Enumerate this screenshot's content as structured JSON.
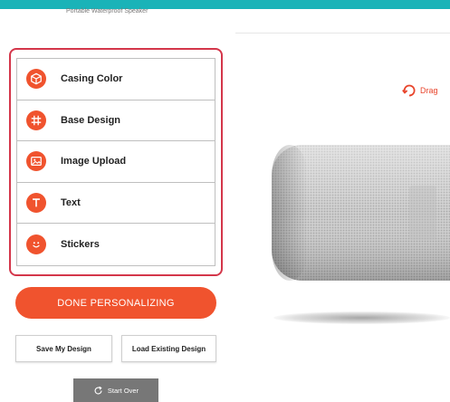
{
  "header": {
    "product_subtitle": "Portable Waterproof Speaker"
  },
  "menu": {
    "items": [
      {
        "label": "Casing Color",
        "icon": "cube-icon"
      },
      {
        "label": "Base Design",
        "icon": "grid-icon"
      },
      {
        "label": "Image Upload",
        "icon": "image-icon"
      },
      {
        "label": "Text",
        "icon": "text-icon"
      },
      {
        "label": "Stickers",
        "icon": "smiley-icon"
      }
    ]
  },
  "actions": {
    "done_label": "DONE PERSONALIZING",
    "save_label": "Save My Design",
    "load_label": "Load Existing Design",
    "start_over_label": "Start Over"
  },
  "preview": {
    "drag_hint": "Drag"
  },
  "colors": {
    "accent": "#f0532e",
    "highlight_border": "#d4364a",
    "top_bar": "#1ab3b8",
    "start_over_bg": "#777777"
  }
}
